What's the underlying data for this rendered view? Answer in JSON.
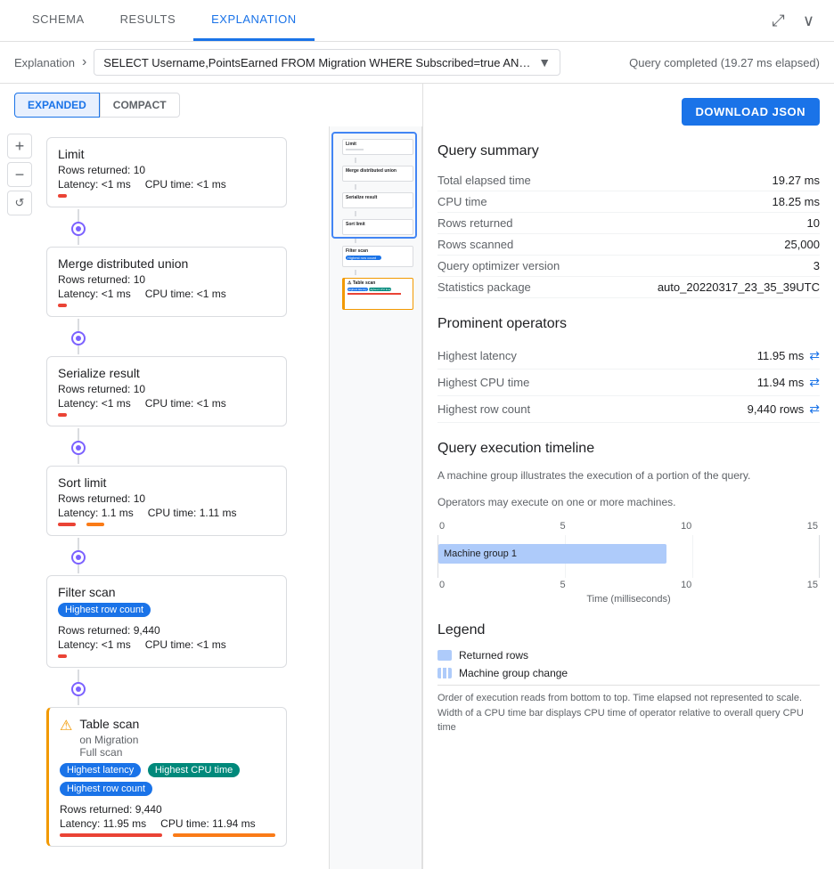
{
  "tabs": [
    {
      "label": "SCHEMA",
      "active": false
    },
    {
      "label": "RESULTS",
      "active": false
    },
    {
      "label": "EXPLANATION",
      "active": true
    }
  ],
  "breadcrumb": {
    "label": "Explanation",
    "arrow": "›",
    "query": "SELECT Username,PointsEarned FROM Migration WHERE Subscribed=true AND ReminderD...",
    "elapsed": "Query completed (19.27 ms elapsed)"
  },
  "view_toggle": {
    "expanded_label": "EXPANDED",
    "compact_label": "COMPACT",
    "active": "expanded"
  },
  "zoom": {
    "plus": "+",
    "minus": "−",
    "reset": "↺"
  },
  "nodes": [
    {
      "id": "limit",
      "title": "Limit",
      "rows": "Rows returned: 10",
      "latency": "Latency: <1 ms",
      "cpu": "CPU time: <1 ms",
      "badges": [],
      "warning": false,
      "subtitle": "",
      "latency_bar_width": 10,
      "cpu_bar_width": 10,
      "bar_type": "small"
    },
    {
      "id": "merge",
      "title": "Merge distributed union",
      "rows": "Rows returned: 10",
      "latency": "Latency: <1 ms",
      "cpu": "CPU time: <1 ms",
      "badges": [],
      "warning": false,
      "subtitle": "",
      "latency_bar_width": 10,
      "cpu_bar_width": 10,
      "bar_type": "small"
    },
    {
      "id": "serialize",
      "title": "Serialize result",
      "rows": "Rows returned: 10",
      "latency": "Latency: <1 ms",
      "cpu": "CPU time: <1 ms",
      "badges": [],
      "warning": false,
      "subtitle": "",
      "latency_bar_width": 10,
      "cpu_bar_width": 10,
      "bar_type": "small"
    },
    {
      "id": "sort",
      "title": "Sort limit",
      "rows": "Rows returned: 10",
      "latency": "Latency: 1.1 ms",
      "cpu": "CPU time: 1.11 ms",
      "badges": [],
      "warning": false,
      "subtitle": "",
      "latency_bar_width": 20,
      "cpu_bar_width": 20,
      "bar_type": "medium"
    },
    {
      "id": "filter",
      "title": "Filter scan",
      "rows": "Rows returned: 9,440",
      "latency": "Latency: <1 ms",
      "cpu": "CPU time: <1 ms",
      "badges": [
        "Highest row count"
      ],
      "badge_colors": [
        "blue"
      ],
      "warning": false,
      "subtitle": "",
      "latency_bar_width": 10,
      "cpu_bar_width": 10,
      "bar_type": "small"
    },
    {
      "id": "tablescan",
      "title": "Table scan",
      "rows": "Rows returned: 9,440",
      "latency": "Latency: 11.95 ms",
      "cpu": "CPU time: 11.94 ms",
      "badges": [
        "Highest latency",
        "Highest CPU time",
        "Highest row count"
      ],
      "badge_colors": [
        "blue",
        "teal",
        "blue"
      ],
      "warning": true,
      "subtitle": "on Migration\nFull scan",
      "latency_bar_width": 120,
      "cpu_bar_width": 120,
      "bar_type": "large"
    }
  ],
  "download_btn": "DOWNLOAD JSON",
  "query_summary": {
    "title": "Query summary",
    "rows": [
      {
        "key": "Total elapsed time",
        "value": "19.27 ms"
      },
      {
        "key": "CPU time",
        "value": "18.25 ms"
      },
      {
        "key": "Rows returned",
        "value": "10"
      },
      {
        "key": "Rows scanned",
        "value": "25,000"
      },
      {
        "key": "Query optimizer version",
        "value": "3"
      },
      {
        "key": "Statistics package",
        "value": "auto_20220317_23_35_39UTC"
      }
    ]
  },
  "prominent_operators": {
    "title": "Prominent operators",
    "rows": [
      {
        "key": "Highest latency",
        "value": "11.95 ms"
      },
      {
        "key": "Highest CPU time",
        "value": "11.94 ms"
      },
      {
        "key": "Highest row count",
        "value": "9,440 rows"
      }
    ]
  },
  "timeline": {
    "title": "Query execution timeline",
    "desc1": "A machine group illustrates the execution of a portion of the query.",
    "desc2": "Operators may execute on one or more machines.",
    "axis_top": [
      "0",
      "5",
      "10",
      "15"
    ],
    "axis_bottom": [
      "0",
      "5",
      "10",
      "15"
    ],
    "xlabel": "Time (milliseconds)",
    "bar_label": "Machine group 1",
    "bar_start_pct": 0,
    "bar_width_pct": 60
  },
  "legend": {
    "title": "Legend",
    "items": [
      {
        "type": "solid",
        "label": "Returned rows"
      },
      {
        "type": "striped",
        "label": "Machine group change"
      }
    ],
    "note": "Order of execution reads from bottom to top.\nTime elapsed not represented to scale.\nWidth of a CPU time bar displays CPU time of operator relative to overall query CPU time"
  }
}
